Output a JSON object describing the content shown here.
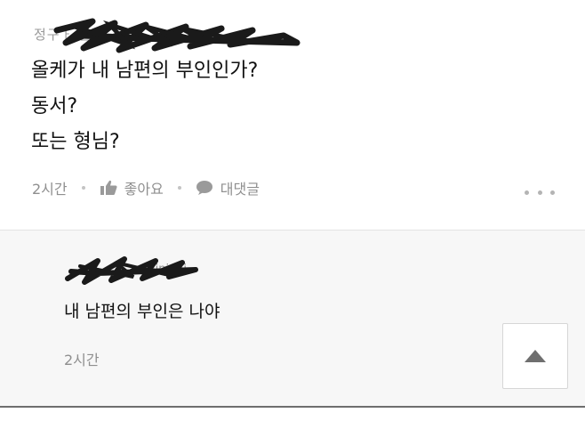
{
  "comment": {
    "author_partial": "정구ㅏ         빨간",
    "lines": [
      "올케가 내 남편의 부인인가?",
      "동서?",
      "또는 형님?"
    ],
    "time": "2시간",
    "like_label": "좋아요",
    "reply_label": "대댓글",
    "more_icon": "more-dots-icon"
  },
  "reply": {
    "author_partial": "minjmji",
    "text": "내 남편의 부인은 나야",
    "time": "2시간"
  },
  "scroll_top_icon": "triangle-up-icon",
  "colors": {
    "text": "#111111",
    "meta": "#8f8f8f",
    "reply_bg": "#f7f7f7",
    "scribble": "#1a1a1a"
  }
}
